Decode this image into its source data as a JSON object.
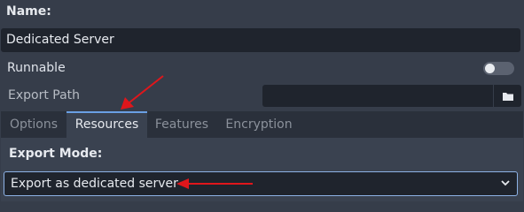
{
  "name_section": {
    "label": "Name:",
    "value": "Dedicated Server"
  },
  "runnable": {
    "label": "Runnable",
    "enabled": false
  },
  "export_path": {
    "label": "Export Path",
    "value": "",
    "button_icon": "folder-icon"
  },
  "tabs": [
    {
      "label": "Options",
      "active": false
    },
    {
      "label": "Resources",
      "active": true
    },
    {
      "label": "Features",
      "active": false
    },
    {
      "label": "Encryption",
      "active": false
    }
  ],
  "export_mode": {
    "label": "Export Mode:",
    "selected": "Export as dedicated server"
  },
  "colors": {
    "accent": "#8db2e6",
    "annotation_arrow": "#e0161b"
  }
}
